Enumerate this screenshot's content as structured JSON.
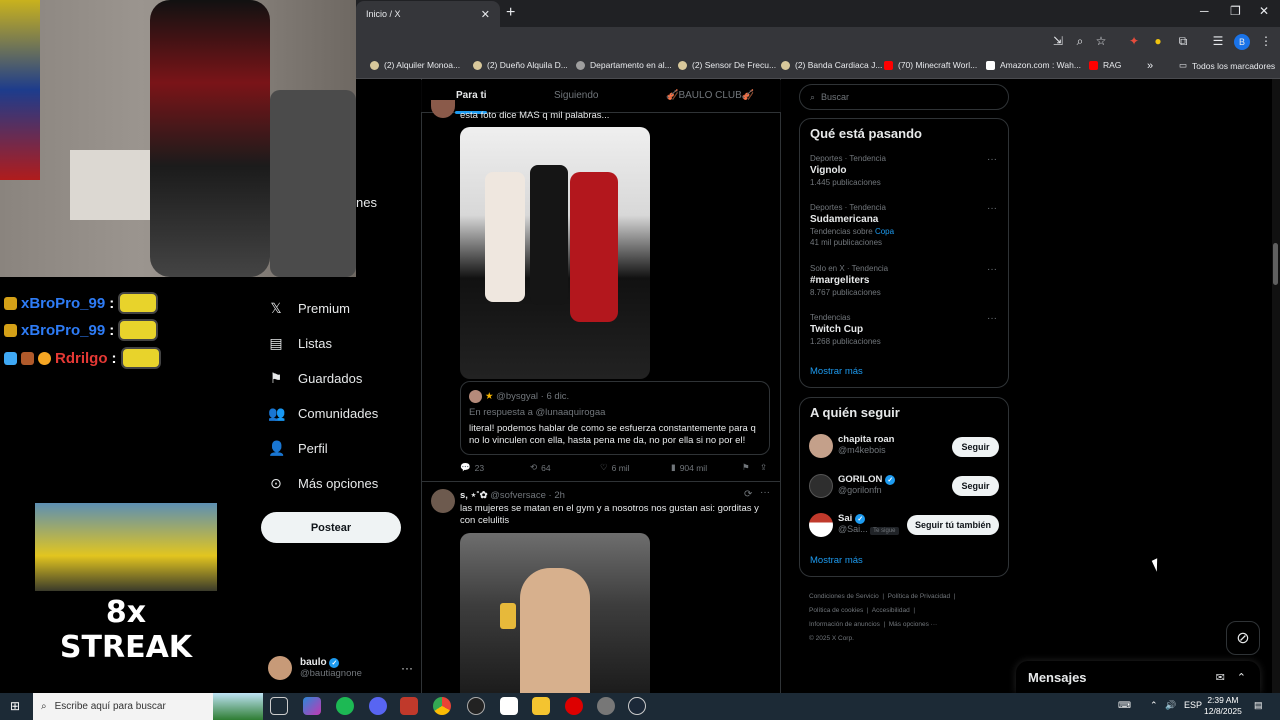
{
  "browser": {
    "tab_title": "Inicio / X",
    "tab_close": "✕",
    "new_tab": "+",
    "bookmarks": [
      {
        "label": "(2) Alquiler Monoa...",
        "color": "#d8c89b"
      },
      {
        "label": "(2) Dueño Alquila D...",
        "color": "#d8c89b"
      },
      {
        "label": "Departamento en al...",
        "color": "#9e9e9e"
      },
      {
        "label": "(2) Sensor De Frecu...",
        "color": "#d8c89b"
      },
      {
        "label": "(2) Banda Cardiaca J...",
        "color": "#d8c89b"
      },
      {
        "label": "(70) Minecraft Worl...",
        "color": "#ff0000"
      },
      {
        "label": "Amazon.com : Wah...",
        "color": "#ffffff"
      },
      {
        "label": "RAG",
        "color": "#ff0000"
      }
    ],
    "bookmarks_more": "»",
    "all_bookmarks": "Todos los marcadores",
    "profile_initial": "B"
  },
  "stream_overlay": {
    "chat": [
      {
        "user": "xBroPro_99",
        "sep": ":"
      },
      {
        "user": "xBroPro_99",
        "sep": ":"
      },
      {
        "user": "Rdrilgo",
        "sep": ":"
      }
    ],
    "streak_text": "8x STREAK",
    "nav_partial_text": "nes"
  },
  "left_nav": {
    "items": [
      {
        "label": "Premium",
        "icon": "x-logo-icon"
      },
      {
        "label": "Listas",
        "icon": "list-icon"
      },
      {
        "label": "Guardados",
        "icon": "bookmark-icon"
      },
      {
        "label": "Comunidades",
        "icon": "communities-icon"
      },
      {
        "label": "Perfil",
        "icon": "person-icon"
      },
      {
        "label": "Más opciones",
        "icon": "more-circle-icon"
      }
    ],
    "post_button": "Postear",
    "account": {
      "name": "baulo",
      "handle": "@bautiagnone",
      "more": "···"
    }
  },
  "feed": {
    "tabs": [
      "Para ti",
      "Siguiendo",
      "🎻BAULO CLUB🎻"
    ],
    "post1": {
      "text": "esta foto dice MAS q mil palabras...",
      "quote": {
        "handle": "@bysgyal",
        "date": "6 dic.",
        "reply_to": "En respuesta a @lunaaquirogaa",
        "text": "literal! podemos hablar de como se esfuerza constantemente para q no lo vinculen con ella, hasta pena me da, no por ella si no por el!"
      },
      "actions": {
        "replies": "23",
        "reposts": "64",
        "likes": "6 mil",
        "views": "904 mil"
      }
    },
    "post2": {
      "name": "s, ⋆˚✿",
      "handle": "@sofversace",
      "time": "2h",
      "text": "las mujeres se matan en el gym y a nosotros nos gustan asi: gorditas y con celulitis"
    }
  },
  "right": {
    "search_placeholder": "Buscar",
    "trends_title": "Qué está pasando",
    "trends": [
      {
        "meta": "Deportes · Tendencia",
        "title": "Vignolo",
        "count": "1.445 publicaciones",
        "extra": ""
      },
      {
        "meta": "Deportes · Tendencia",
        "title": "Sudamericana",
        "count": "41 mil publicaciones",
        "extra": "Tendencias sobre",
        "extra_link": "Copa"
      },
      {
        "meta": "Solo en X · Tendencia",
        "title": "#margeliters",
        "count": "8.767 publicaciones",
        "extra": ""
      },
      {
        "meta": "Tendencias",
        "title": "Twitch Cup",
        "count": "1.268 publicaciones",
        "extra": ""
      }
    ],
    "show_more": "Mostrar más",
    "follow_title": "A quién seguir",
    "follow": [
      {
        "name": "chapita roan",
        "handle": "@m4kebois",
        "button": "Seguir",
        "verified": false
      },
      {
        "name": "GORILON",
        "handle": "@gorilonfn",
        "button": "Seguir",
        "verified": true
      },
      {
        "name": "Sai",
        "handle": "@Sai...",
        "button": "Seguir tú también",
        "verified": true,
        "follows_you": "Te sigue"
      }
    ],
    "follow_more": "Mostrar más",
    "footer": [
      "Condiciones de Servicio",
      "Política de Privacidad",
      "Política de cookies",
      "Accesibilidad",
      "Información de anuncios",
      "Más opciones ···",
      "© 2025 X Corp."
    ]
  },
  "messages": {
    "title": "Mensajes"
  },
  "taskbar": {
    "search_placeholder": "Escribe aquí para buscar",
    "lang": "ESP",
    "time": "2:39 AM",
    "date": "12/8/2025"
  }
}
